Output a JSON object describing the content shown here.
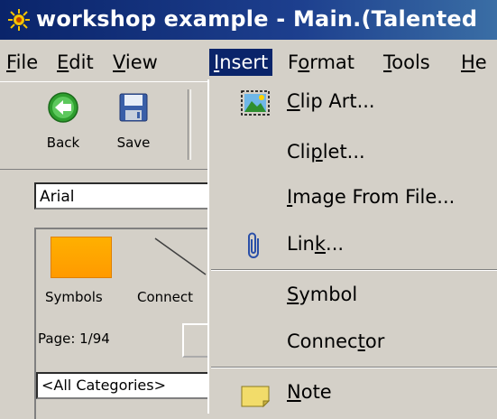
{
  "window": {
    "title": "workshop example - Main.(Talented"
  },
  "menubar": {
    "items": [
      {
        "pre": "",
        "key": "F",
        "post": "ile"
      },
      {
        "pre": "",
        "key": "E",
        "post": "dit"
      },
      {
        "pre": "",
        "key": "V",
        "post": "iew"
      },
      {
        "pre": "",
        "key": "I",
        "post": "nsert"
      },
      {
        "pre": "F",
        "key": "o",
        "post": "rmat"
      },
      {
        "pre": "",
        "key": "T",
        "post": "ools"
      },
      {
        "pre": "",
        "key": "H",
        "post": "e"
      }
    ]
  },
  "toolbar": {
    "back_label": "Back",
    "save_label": "Save"
  },
  "font": {
    "value": "Arial"
  },
  "panel": {
    "symbols_label": "Symbols",
    "connectors_label": "Connect",
    "page_label": "Page: 1/94",
    "category_value": "<All Categories>"
  },
  "insert_menu": {
    "items": [
      {
        "pre": "",
        "key": "C",
        "post": "lip Art...",
        "icon": "clip-art-icon"
      },
      {
        "pre": "Cli",
        "key": "p",
        "post": "let...",
        "icon": ""
      },
      {
        "pre": "",
        "key": "I",
        "post": "mage From File...",
        "icon": ""
      },
      {
        "pre": "Lin",
        "key": "k",
        "post": "...",
        "icon": "paperclip-icon"
      },
      {
        "pre": "",
        "key": "S",
        "post": "ymbol",
        "icon": ""
      },
      {
        "pre": "Connec",
        "key": "t",
        "post": "or",
        "icon": ""
      },
      {
        "pre": "",
        "key": "N",
        "post": "ote",
        "icon": "note-icon"
      }
    ]
  },
  "colors": {
    "menu_highlight": "#0a246a",
    "symbol_swatch": "#ffa500",
    "chrome": "#d4d0c8"
  }
}
